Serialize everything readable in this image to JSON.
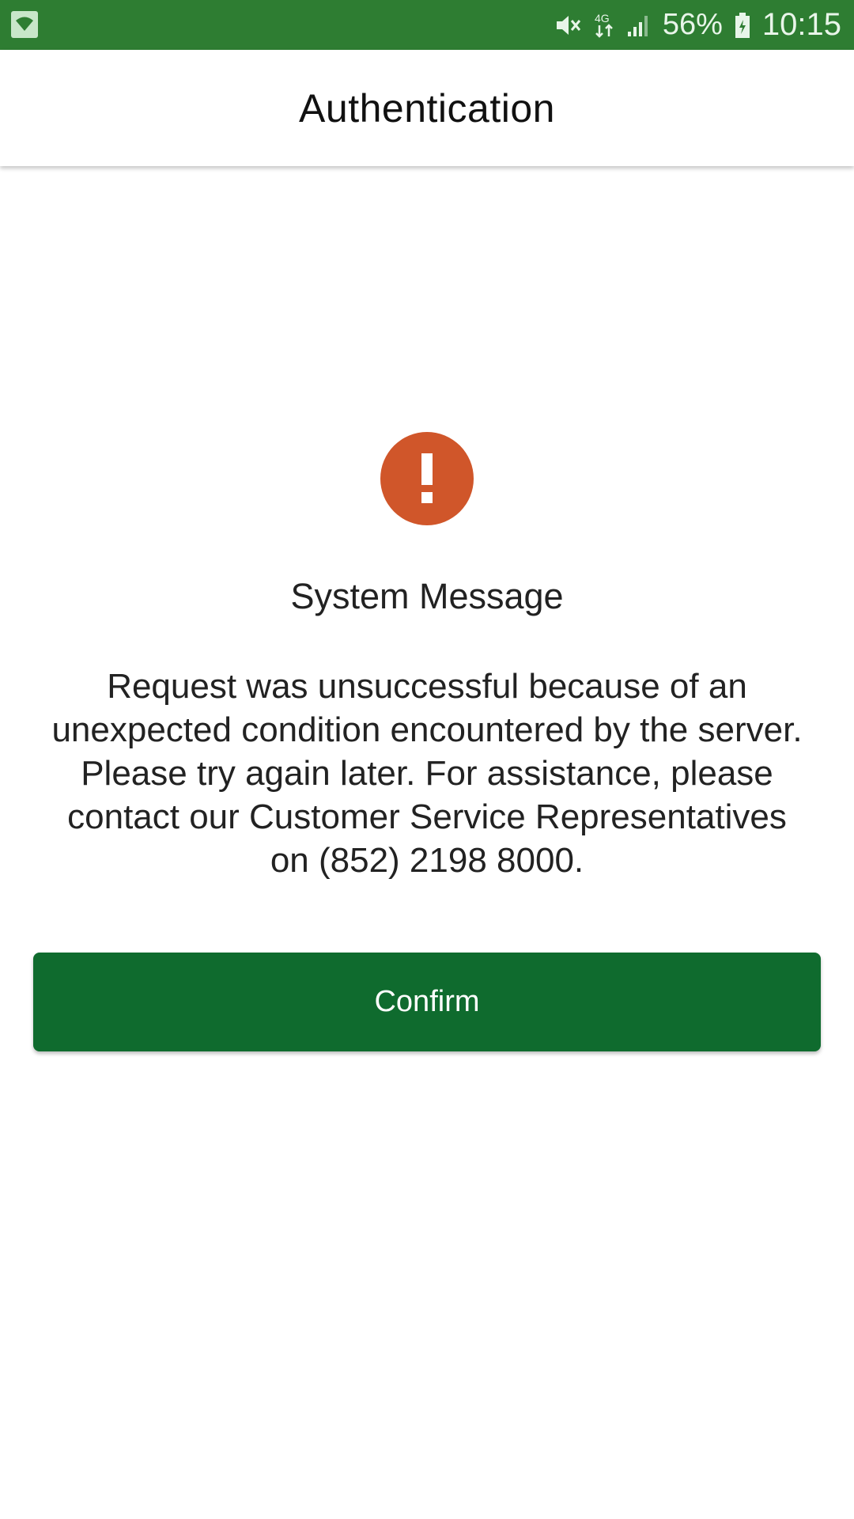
{
  "status_bar": {
    "left_icon": "wifi-icon",
    "icons": [
      "mute-icon",
      "network-4g-icon",
      "signal-icon",
      "battery-icon"
    ],
    "network_label": "4G",
    "battery_percent": "56%",
    "time": "10:15"
  },
  "app_bar": {
    "title": "Authentication"
  },
  "message": {
    "icon": "alert-icon",
    "title": "System Message",
    "body": "Request was unsuccessful because of an unexpected condition encountered by the server. Please try again later. For assistance, please contact our Customer Service Representatives on (852) 2198 8000."
  },
  "actions": {
    "confirm_label": "Confirm"
  },
  "colors": {
    "status_bar": "#2e7d32",
    "alert_icon": "#d0562a",
    "confirm_button": "#0f6b2e"
  }
}
